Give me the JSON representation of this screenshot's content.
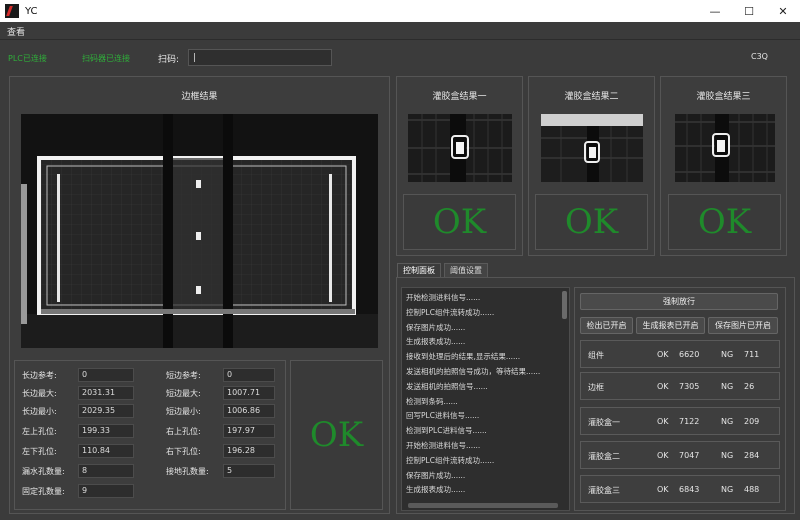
{
  "window": {
    "title": "YC",
    "minimize": "—",
    "maximize": "☐",
    "close": "✕"
  },
  "menu": {
    "view": "查看"
  },
  "status": {
    "left1": "PLC已连接",
    "left2": "扫码器已连接",
    "scan_label": "扫码:",
    "scan_value": "|",
    "right": "C3Q"
  },
  "frame": {
    "title": "边框结果",
    "params": [
      {
        "label": "长边参考:",
        "value": "0"
      },
      {
        "label": "长边最大:",
        "value": "2031.31"
      },
      {
        "label": "长边最小:",
        "value": "2029.35"
      },
      {
        "label": "左上孔位:",
        "value": "199.33"
      },
      {
        "label": "左下孔位:",
        "value": "110.84"
      },
      {
        "label": "漏水孔数量:",
        "value": "8"
      },
      {
        "label": "固定孔数量:",
        "value": "9"
      }
    ],
    "params_right": [
      {
        "label": "短边参考:",
        "value": "0"
      },
      {
        "label": "短边最大:",
        "value": "1007.71"
      },
      {
        "label": "短边最小:",
        "value": "1006.86"
      },
      {
        "label": "右上孔位:",
        "value": "197.97"
      },
      {
        "label": "右下孔位:",
        "value": "196.28"
      },
      {
        "label": "接地孔数量:",
        "value": "5"
      }
    ],
    "result": "OK"
  },
  "glue": [
    {
      "title": "灌胶盒结果一",
      "result": "OK"
    },
    {
      "title": "灌胶盒结果二",
      "result": "OK"
    },
    {
      "title": "灌胶盒结果三",
      "result": "OK"
    }
  ],
  "tabs": {
    "control": "控制面板",
    "threshold": "阈值设置"
  },
  "log": [
    "开始检测进料信号......",
    "控制PLC组件流转成功......",
    "保存图片成功......",
    "生成报表成功......",
    "接收到处理后的结果,显示结果......",
    "发送相机的拍照信号成功，等待结果......",
    "发送相机的拍照信号......",
    "检测到条码......",
    "回写PLC进料信号......",
    "检测到PLC进料信号......",
    "开始检测进料信号......",
    "控制PLC组件流转成功......",
    "保存图片成功......",
    "生成报表成功......"
  ],
  "controls": {
    "force_pass": "强制放行",
    "detect_on": "检出已开启",
    "report_on": "生成报表已开启",
    "save_img_on": "保存图片已开启"
  },
  "stats": [
    {
      "name": "组件",
      "ok_label": "OK",
      "ok": "6620",
      "ng_label": "NG",
      "ng": "711"
    },
    {
      "name": "边框",
      "ok_label": "OK",
      "ok": "7305",
      "ng_label": "NG",
      "ng": "26"
    },
    {
      "name": "灌胶盒一",
      "ok_label": "OK",
      "ok": "7122",
      "ng_label": "NG",
      "ng": "209"
    },
    {
      "name": "灌胶盒二",
      "ok_label": "OK",
      "ok": "7047",
      "ng_label": "NG",
      "ng": "284"
    },
    {
      "name": "灌胶盒三",
      "ok_label": "OK",
      "ok": "6843",
      "ng_label": "NG",
      "ng": "488"
    }
  ],
  "colors": {
    "ok_green": "#1f8a2b",
    "status_green": "#2fae3a",
    "background": "#3b3b3b"
  }
}
